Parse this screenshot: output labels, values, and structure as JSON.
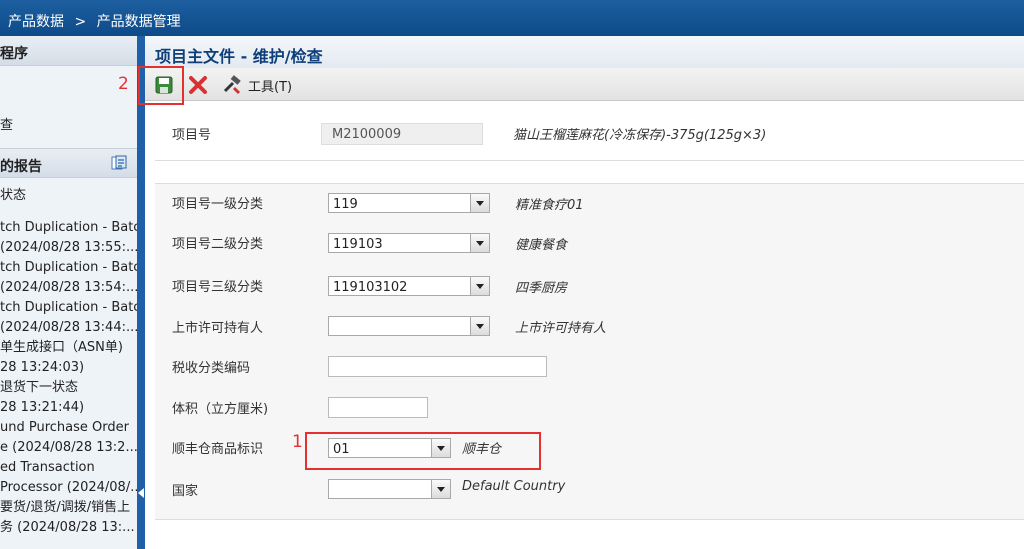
{
  "breadcrumb": {
    "root": "产品数据",
    "sep": ">",
    "current": "产品数据管理"
  },
  "sidebar": {
    "header": "程序",
    "items": [
      "查"
    ],
    "reports_header": "的报告",
    "reports": [
      "状态",
      "tch Duplication - Batch",
      "(2024/08/28 13:55:...",
      "tch Duplication - Batch",
      "(2024/08/28 13:54:...",
      "tch Duplication - Batch",
      "(2024/08/28 13:44:...",
      "单生成接口（ASN单)",
      "28 13:24:03)",
      "退货下一状态",
      "28 13:21:44)",
      "und Purchase Order",
      "e (2024/08/28 13:2...",
      "ed Transaction",
      "Processor (2024/08/...",
      "要货/退货/调拨/销售上",
      "务 (2024/08/28 13:..."
    ]
  },
  "page": {
    "title": "项目主文件 - 维护/检查"
  },
  "toolbar": {
    "tools_label": "工具(T)"
  },
  "form": {
    "item_no_label": "项目号",
    "item_no_value": "M2100009",
    "item_desc": "猫山王榴莲麻花(冷冻保存)-375g(125g×3)",
    "cat1_label": "项目号一级分类",
    "cat1_value": "119",
    "cat1_desc": "精准食疗01",
    "cat2_label": "项目号二级分类",
    "cat2_value": "119103",
    "cat2_desc": "健康餐食",
    "cat3_label": "项目号三级分类",
    "cat3_value": "119103102",
    "cat3_desc": "四季厨房",
    "holder_label": "上市许可持有人",
    "holder_value": "",
    "holder_desc": "上市许可持有人",
    "tax_label": "税收分类编码",
    "tax_value": "",
    "volume_label": "体积（立方厘米)",
    "volume_value": "",
    "sf_label": "顺丰仓商品标识",
    "sf_value": "01",
    "sf_desc": "顺丰仓",
    "country_label": "国家",
    "country_value": "",
    "country_desc": "Default Country"
  },
  "annotations": {
    "num1": "1",
    "num2": "2"
  },
  "colors": {
    "topbar": "#0e4a88",
    "title": "#0f3f7a",
    "annotation": "#e53030"
  }
}
